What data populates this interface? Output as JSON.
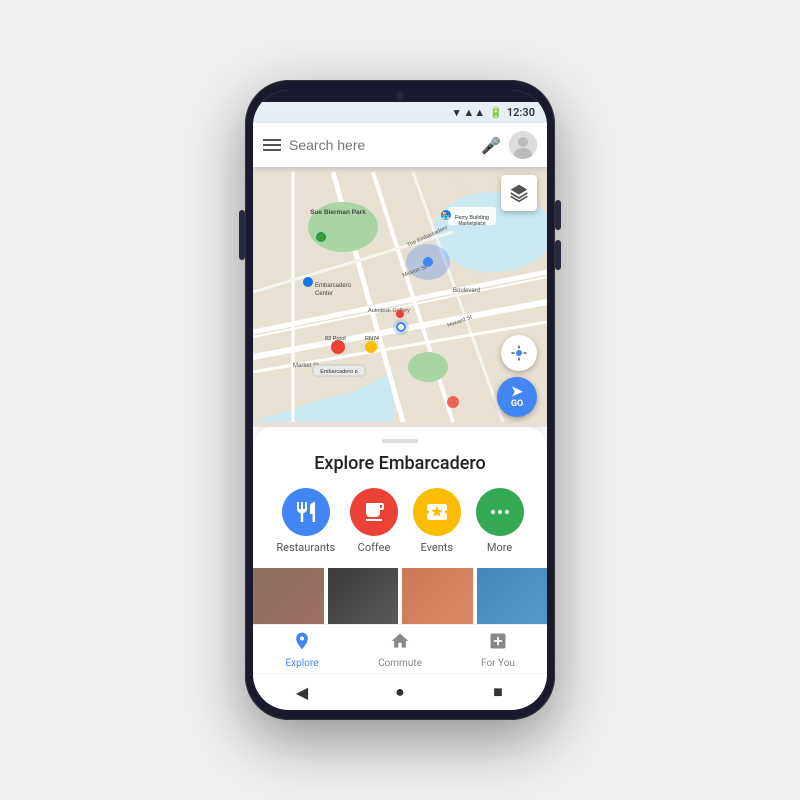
{
  "phone": {
    "status_bar": {
      "time": "12:30"
    },
    "search": {
      "placeholder": "Search here"
    },
    "map": {
      "location_name": "Embarcadero",
      "labels": [
        "Sue Bierman Park",
        "Ferry Building Marketplace",
        "Embarcadero Center",
        "Autodesk Gallery",
        "Boulevard",
        "Embarcadero",
        "Market St",
        "83 Proof",
        "RN74",
        "Mission St",
        "Howard St"
      ],
      "go_label": "GO"
    },
    "explore": {
      "title": "Explore Embarcadero",
      "categories": [
        {
          "id": "restaurants",
          "label": "Restaurants",
          "icon": "🍴",
          "color": "#4285f4"
        },
        {
          "id": "coffee",
          "label": "Coffee",
          "icon": "☕",
          "color": "#ea4335"
        },
        {
          "id": "events",
          "label": "Events",
          "icon": "🎟",
          "color": "#fbbc04"
        },
        {
          "id": "more",
          "label": "More",
          "icon": "•••",
          "color": "#34a853"
        }
      ]
    },
    "bottom_nav": [
      {
        "id": "explore",
        "label": "Explore",
        "icon": "📍",
        "active": true
      },
      {
        "id": "commute",
        "label": "Commute",
        "icon": "🏠"
      },
      {
        "id": "for_you",
        "label": "For You",
        "icon": "➕"
      }
    ],
    "android_nav": {
      "back": "◀",
      "home": "●",
      "recents": "■"
    }
  }
}
